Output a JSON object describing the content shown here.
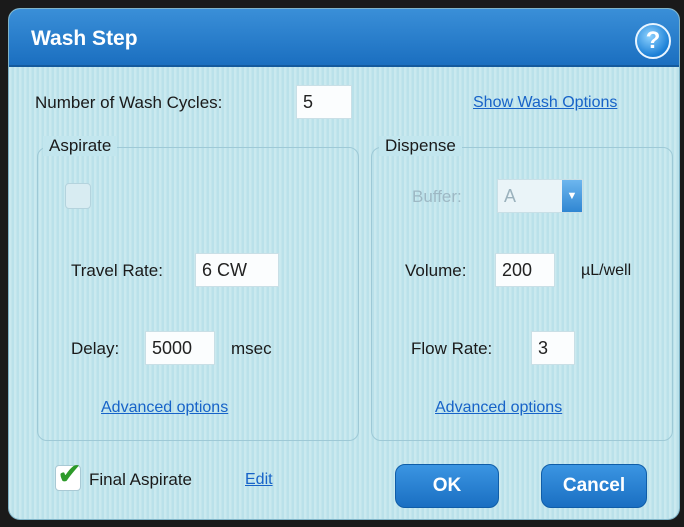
{
  "dialog": {
    "title": "Wash Step",
    "help_icon": "help-icon",
    "help_label": "?"
  },
  "wash_cycles": {
    "label": "Number of Wash Cycles:",
    "value": "5",
    "show_options_link": "Show Wash Options"
  },
  "aspirate": {
    "title": "Aspirate",
    "disabled_checkbox_label": "",
    "travel_rate_label": "Travel Rate:",
    "travel_rate_value": "6 CW",
    "delay_label": "Delay:",
    "delay_value": "5000",
    "delay_unit": "msec",
    "advanced_link": "Advanced options"
  },
  "dispense": {
    "title": "Dispense",
    "buffer_label": "Buffer:",
    "buffer_value": "A",
    "volume_label": "Volume:",
    "volume_value": "200",
    "volume_unit": "µL/well",
    "flow_rate_label": "Flow Rate:",
    "flow_rate_value": "3",
    "advanced_link": "Advanced options"
  },
  "final_aspirate": {
    "checked": true,
    "label": "Final Aspirate",
    "edit_link": "Edit"
  },
  "buttons": {
    "ok": "OK",
    "cancel": "Cancel"
  },
  "colors": {
    "titlebar": "#1b6fc0",
    "background": "#bfe4ec",
    "link": "#1763c8",
    "button": "#1a6fc2",
    "check": "#2d9a2a"
  }
}
